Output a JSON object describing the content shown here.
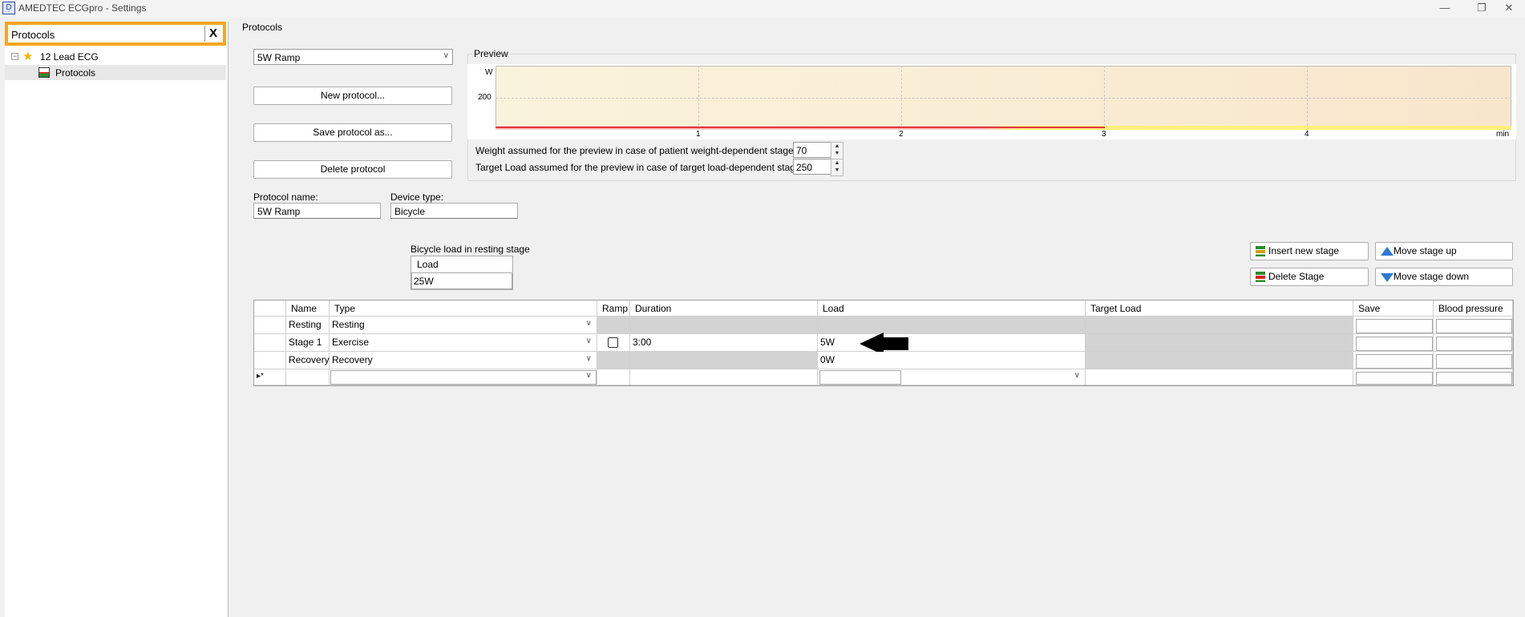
{
  "window": {
    "title": "AMEDTEC ECGpro  -  Settings",
    "app_icon_glyph": "D",
    "min_glyph": "—",
    "restore_glyph": "❐",
    "close_glyph": "✕"
  },
  "sidebar": {
    "search_value": "Protocols",
    "clear_label": "X",
    "tree": [
      {
        "label": "12 Lead ECG",
        "expanded": true,
        "icon": "star-icon"
      },
      {
        "label": "Protocols",
        "selected": true,
        "icon": "protocol-icon"
      }
    ],
    "toggle_glyph": "−",
    "star_glyph": "★"
  },
  "main": {
    "section_title": "Protocols",
    "protocol_select": "5W Ramp",
    "combo_arrow": "∨",
    "buttons": {
      "new_protocol": "New protocol...",
      "save_protocol_as": "Save protocol as...",
      "delete_protocol": "Delete protocol"
    },
    "preview": {
      "label": "Preview",
      "y_unit": "W",
      "y_tick": "200",
      "x_ticks": [
        "1",
        "2",
        "3",
        "4"
      ],
      "x_unit": "min",
      "weight_label": "Weight assumed for the preview in case of patient weight-dependent stages (kg):",
      "weight_value": "70",
      "target_label": "Target Load assumed for the preview in case of target load-dependent stages (W):",
      "target_value": "250",
      "spin_up": "▲",
      "spin_down": "▼"
    },
    "protocol_name_label": "Protocol name:",
    "protocol_name_value": "5W Ramp",
    "device_type_label": "Device type:",
    "device_type_value": "Bicycle",
    "resting_load": {
      "label": "Bicycle load in resting stage",
      "column": "Load",
      "value": "25W"
    },
    "stage_buttons": {
      "insert": "Insert new stage",
      "move_up": "Move stage up",
      "delete": "Delete Stage",
      "move_down": "Move stage down"
    },
    "table": {
      "headers": [
        "Name",
        "Type",
        "Ramp",
        "Duration",
        "Load",
        "Target Load",
        "Save",
        "Blood pressure"
      ],
      "rows": [
        {
          "name": "Resting",
          "type": "Resting",
          "ramp": "",
          "duration": "",
          "load": "",
          "target_load": ""
        },
        {
          "name": "Stage 1",
          "type": "Exercise",
          "ramp": "unchecked",
          "duration": "3:00",
          "load": "5W",
          "target_load": ""
        },
        {
          "name": "Recovery",
          "type": "Recovery",
          "ramp": "",
          "duration": "",
          "load": "0W",
          "target_load": ""
        }
      ],
      "new_row_marker": "▸*"
    }
  },
  "colors": {
    "search_highlight": "#f5a623",
    "preview_bg": "#faf3dc",
    "ramp_line": "#e3383a",
    "disabled_cell": "#d3d3d3"
  }
}
